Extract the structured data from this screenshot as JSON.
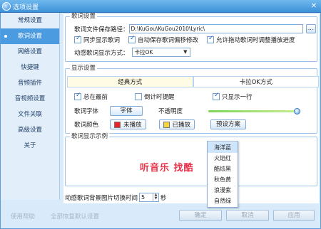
{
  "window": {
    "title": "选项设置",
    "close": "✕"
  },
  "sidebar": {
    "items": [
      {
        "label": "常规设置"
      },
      {
        "label": "歌词设置"
      },
      {
        "label": "网络设置"
      },
      {
        "label": "快捷键"
      },
      {
        "label": "音频插件"
      },
      {
        "label": "音视频设置"
      },
      {
        "label": "文件关联"
      },
      {
        "label": "高级设置"
      },
      {
        "label": "关于"
      }
    ],
    "active_index": 1
  },
  "lyrics_settings": {
    "legend": "歌词设置",
    "path_label": "歌词文件保存路径：",
    "path_value": "D:\\KuGou\\KuGou2010\\Lyric\\",
    "browse_label": "...",
    "sync_display": "同步显示歌词",
    "auto_save_offset": "自动保存歌词偏移修改",
    "allow_drag": "允许拖动歌词时调整播放进度",
    "display_mode_label": "动感歌词显示方式：",
    "display_mode_value": "卡拉OK"
  },
  "display_settings": {
    "legend": "显示设置",
    "tab_classic": "经典方式",
    "tab_karaoke": "卡拉OK方式",
    "always_on_top": "总在最前",
    "countdown": "倒计时提醒",
    "single_line": "只显示一行",
    "font_label": "歌词字体",
    "font_button": "字体",
    "opacity_label": "不透明度",
    "opacity_level": 0.97,
    "color_label": "歌词颜色",
    "unplayed_label": "未播放",
    "played_label": "已播放",
    "preset_button": "预设方案",
    "colors": {
      "unplayed": "#e8232a",
      "played": "#f6d43c",
      "accent": "#4b9be0"
    }
  },
  "preview": {
    "legend": "歌词显示示例",
    "text": "听音乐 找酷"
  },
  "preset_menu": {
    "items": [
      "海洋蓝",
      "火焰红",
      "酷炫黑",
      "秋色黄",
      "浪漫紫",
      "自然绿"
    ],
    "highlighted_index": 0
  },
  "bg_switch": {
    "label_before": "动感歌词背景图片切换时间",
    "value": "5",
    "unit": "秒"
  },
  "footer": {
    "help": "使用帮助",
    "restore_defaults": "全部恢复默认设置",
    "ok": "确定",
    "cancel": "取消",
    "apply": "应用"
  }
}
